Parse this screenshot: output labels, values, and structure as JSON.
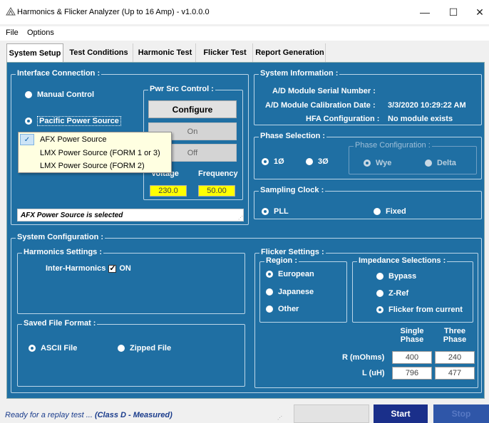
{
  "window": {
    "title": "Harmonics & Flicker Analyzer (Up to 16 Amp) - v1.0.0.0",
    "minimize": "—",
    "maximize": "☐",
    "close": "✕"
  },
  "menu": {
    "file": "File",
    "options": "Options"
  },
  "tabs": [
    {
      "label": "System Setup",
      "active": true
    },
    {
      "label": "Test Conditions"
    },
    {
      "label": "Harmonic Test"
    },
    {
      "label": "Flicker Test"
    },
    {
      "label": "Report Generation"
    }
  ],
  "interface": {
    "title": "Interface Connection :",
    "manual": "Manual Control",
    "pacific": "Pacific Power Source",
    "status": "AFX Power Source is selected",
    "dropdown": [
      "AFX Power Source",
      "LMX Power Source (FORM 1 or 3)",
      "LMX Power Source (FORM 2)"
    ],
    "dropdown_check": "✓"
  },
  "pwr": {
    "title": "Pwr Src Control :",
    "configure": "Configure",
    "on": "On",
    "off": "Off",
    "voltage_label": "Voltage",
    "frequency_label": "Frequency",
    "voltage": "230.0",
    "frequency": "50.00"
  },
  "sysinfo": {
    "title": "System Information :",
    "serial_label": "A/D Module Serial Number :",
    "calib_label": "A/D Module Calibration Date :",
    "calib_value": "3/3/2020  10:29:22 AM",
    "hfa_label": "HFA Configuration :",
    "hfa_value": "No module exists"
  },
  "phase": {
    "title": "Phase Selection :",
    "one": "1Ø",
    "three": "3Ø",
    "config_title": "Phase Configuration :",
    "wye": "Wye",
    "delta": "Delta"
  },
  "sampling": {
    "title": "Sampling Clock :",
    "pll": "PLL",
    "fixed": "Fixed"
  },
  "syscfg": {
    "title": "System Configuration :"
  },
  "harmonics": {
    "title": "Harmonics Settings :",
    "inter_label": "Inter-Harmonics",
    "on": "ON"
  },
  "saved": {
    "title": "Saved File Format :",
    "ascii": "ASCII File",
    "zipped": "Zipped File"
  },
  "flicker": {
    "title": "Flicker Settings :",
    "region_title": "Region :",
    "european": "European",
    "japanese": "Japanese",
    "other": "Other",
    "imp_title": "Impedance Selections :",
    "bypass": "Bypass",
    "zref": "Z-Ref",
    "from_current": "Flicker from current",
    "single_phase": "Single Phase",
    "three_phase": "Three Phase",
    "r_label": "R (mOhms)",
    "l_label": "L (uH)",
    "r_single": "400",
    "r_three": "240",
    "l_single": "796",
    "l_three": "477"
  },
  "statusbar": {
    "text": "Ready for a replay test ... ",
    "class_text": "(Class D - Measured)",
    "start": "Start",
    "stop": "Stop"
  }
}
